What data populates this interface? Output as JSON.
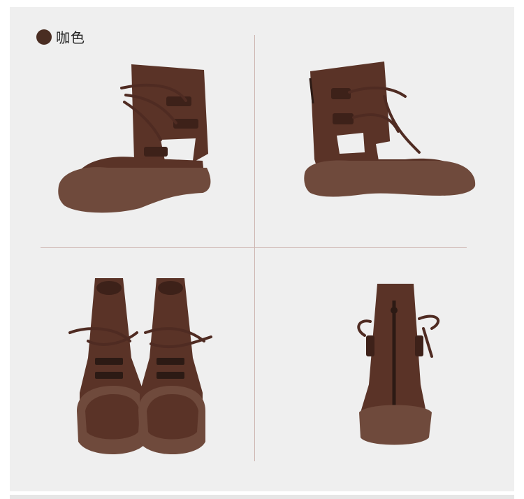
{
  "color_option": {
    "label": "咖色",
    "swatch_color": "#4a2d22"
  },
  "palette": {
    "leather": "#5a3327",
    "leather_dark": "#3d2119",
    "sole": "#6f4a3c",
    "lace": "#4f2b22"
  },
  "views": [
    {
      "name": "side-view-left"
    },
    {
      "name": "side-view-right"
    },
    {
      "name": "top-view-pair"
    },
    {
      "name": "back-view-zipper"
    }
  ]
}
